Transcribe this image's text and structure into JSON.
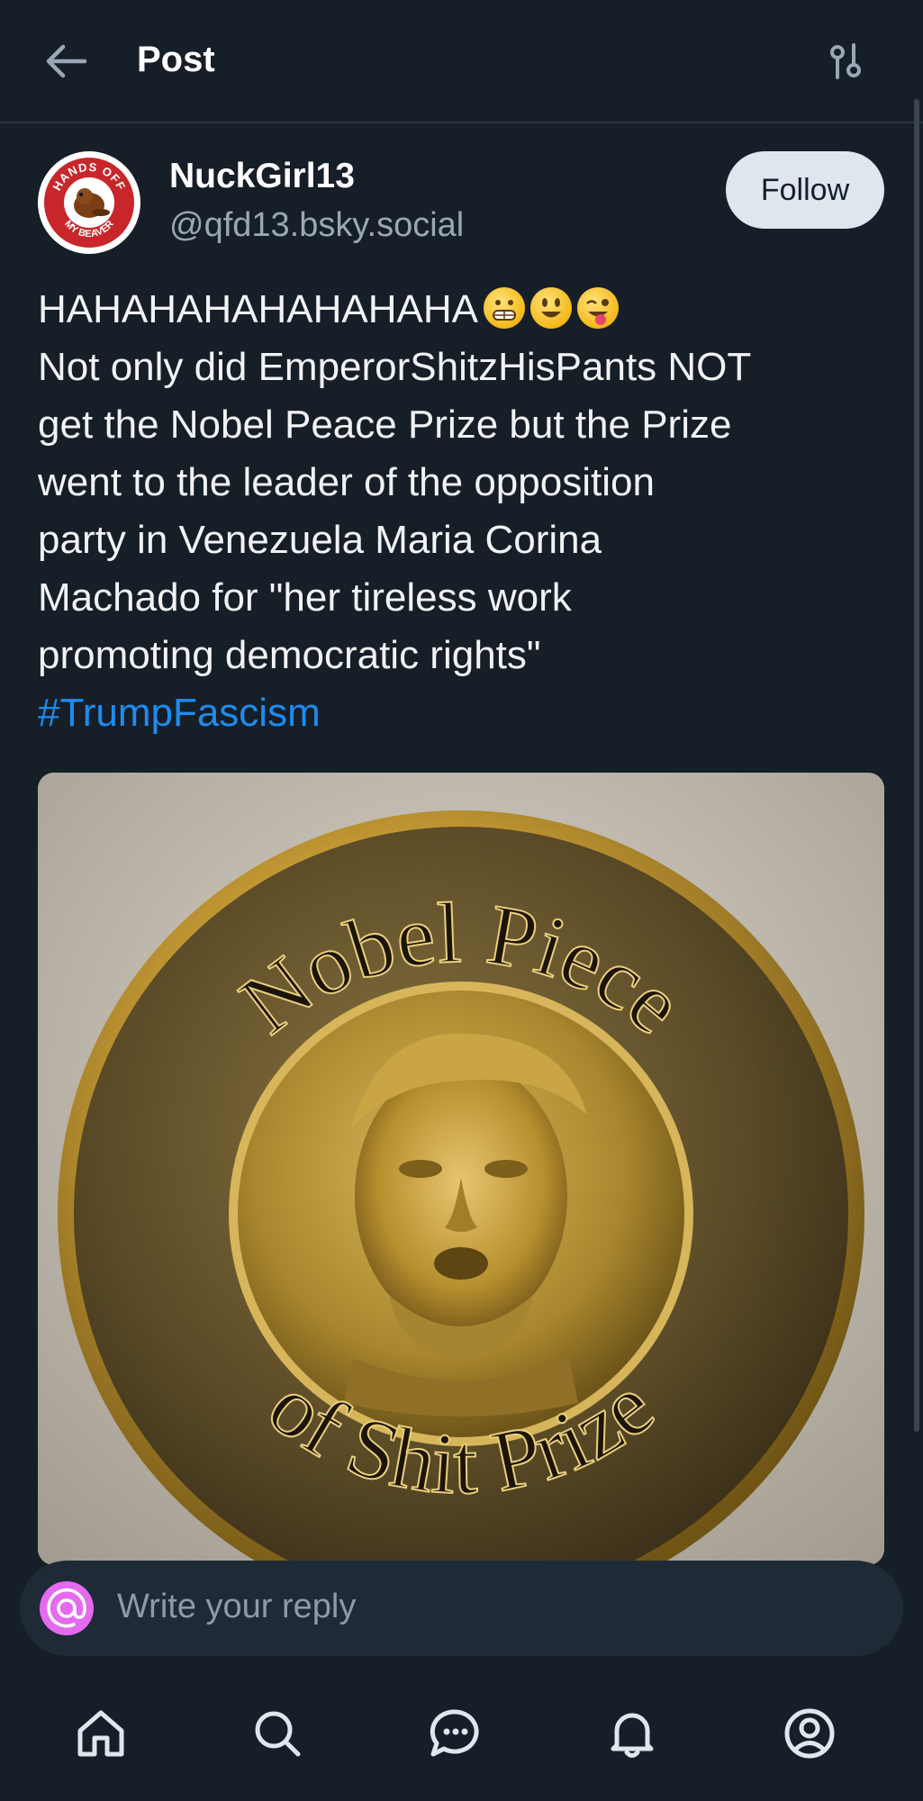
{
  "header": {
    "title": "Post",
    "back_icon": "arrow-left-icon",
    "filter_icon": "thread-options-icon"
  },
  "author": {
    "display_name": "NuckGirl13",
    "handle": "@qfd13.bsky.social",
    "avatar_text_top": "HANDS OFF",
    "avatar_text_bottom": "MY BEAVER",
    "follow_label": "Follow"
  },
  "post": {
    "lines": [
      "HAHAHAHAHAHAHAHA",
      "Not only did EmperorShitzHisPants NOT",
      "get the Nobel Peace Prize but the Prize",
      "went to the leader of the opposition",
      "party in Venezuela Maria Corina",
      "Machado for \"her tireless work",
      "promoting democratic rights\""
    ],
    "emojis": [
      "grinning-teeth-emoji",
      "smiley-emoji",
      "winking-tongue-emoji"
    ],
    "hashtag": "#TrumpFascism",
    "image": {
      "top_text": "Nobel Piece",
      "bottom_text": "of Shit Prize"
    }
  },
  "reply": {
    "placeholder": "Write your reply"
  },
  "nav": {
    "items": [
      "home-icon",
      "search-icon",
      "chat-icon",
      "notifications-icon",
      "profile-icon"
    ]
  },
  "colors": {
    "background": "#161e27",
    "accent_link": "#1d8cf0",
    "follow_bg": "#dfe6ee",
    "reply_bar": "#1f2a37"
  }
}
